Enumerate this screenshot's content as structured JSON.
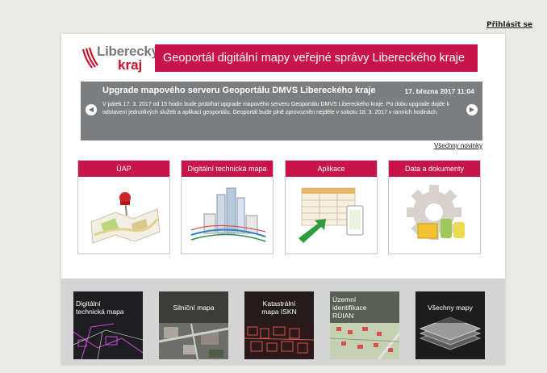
{
  "header": {
    "login_link": "Přihlásit se",
    "logo": {
      "word1": "Liberecký",
      "word2": "kraj"
    },
    "banner_title": "Geoportál digitální mapy veřejné správy Libereckého kraje"
  },
  "news": {
    "title": "Upgrade mapového serveru Geoportálu DMVS Libereckého kraje",
    "date": "17. března 2017 11:04",
    "body": "V pátek 17. 3. 2017 od 15 hodin bude probíhat upgrade mapového serveru Geoportálu DMVS Libereckého kraje. Po dobu upgrade dojde k odstavení jednotlivých služeb a aplikací geoportálu. Geoportál bude plně zprovozněn nejdéle v sobotu 18. 3. 2017 v ranních hodinách.",
    "prev_icon": "chevron-left-icon",
    "next_icon": "chevron-right-icon",
    "all_news_link": "Všechny novinky"
  },
  "cards": [
    {
      "label": "ÚAP",
      "icon": "map-pin-icon"
    },
    {
      "label": "Digitální technická mapa",
      "icon": "city-lines-icon"
    },
    {
      "label": "Aplikace",
      "icon": "app-table-icon"
    },
    {
      "label": "Data a dokumenty",
      "icon": "gear-folder-icon"
    }
  ],
  "maps": [
    {
      "label": "Digitální\ntechnická mapa"
    },
    {
      "label": "Silniční mapa"
    },
    {
      "label": "Katastrální\nmapa ISKN"
    },
    {
      "label": "Územní\nidentifikace\nRÚIAN"
    },
    {
      "label": "Všechny mapy"
    }
  ],
  "colors": {
    "brand": "#c8144a",
    "news_bg": "#7b7d7f",
    "page_bg": "#e9e9e6",
    "strip_bg": "#d4d4d4"
  }
}
